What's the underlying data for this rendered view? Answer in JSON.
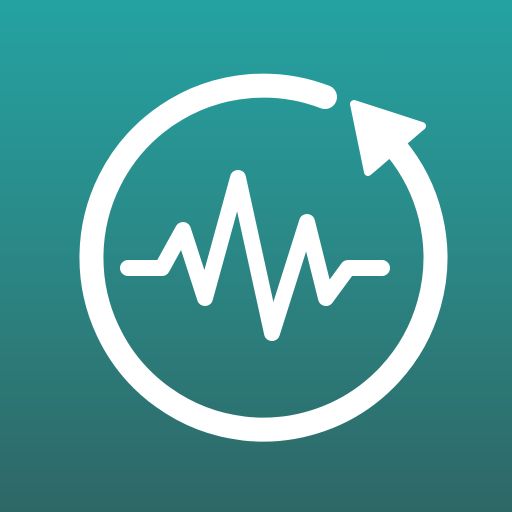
{
  "icon": {
    "name": "refresh-waveform-icon",
    "parts": [
      "circular-refresh-arrow",
      "audio-waveform"
    ]
  },
  "colors": {
    "background_top": "#24a2a2",
    "background_mid": "#2a8a88",
    "background_bottom": "#2e6766",
    "foreground": "#ffffff"
  }
}
